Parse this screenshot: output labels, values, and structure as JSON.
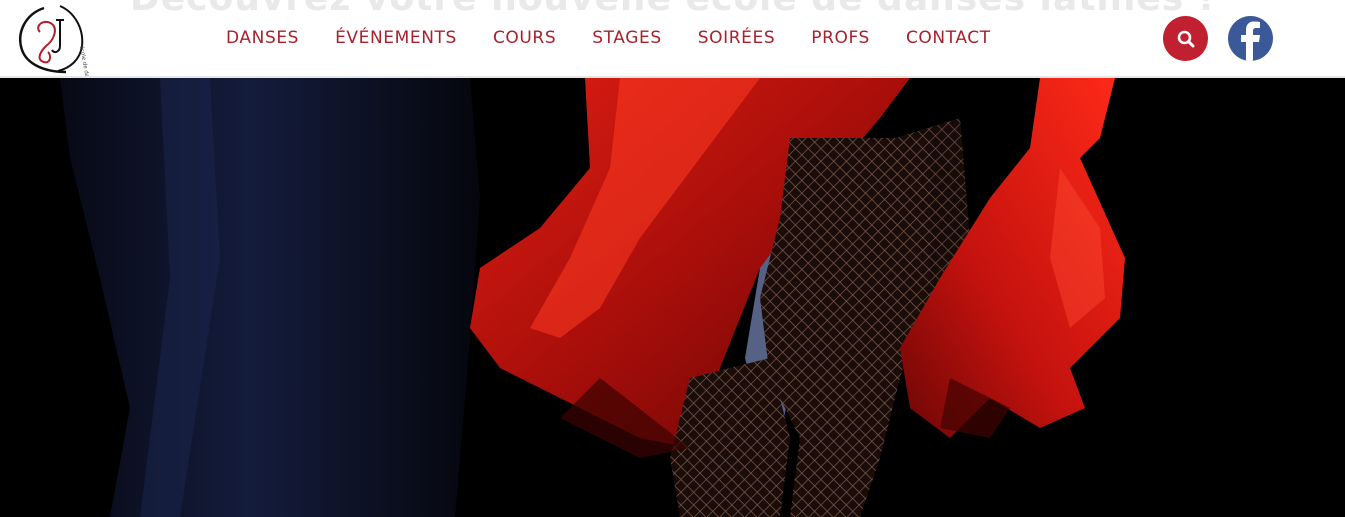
{
  "headline": {
    "text": "Découvrez votre nouvelle école de danses latines !"
  },
  "logo": {
    "tagline": "école de danse"
  },
  "nav": {
    "items": [
      {
        "label": "DANSES"
      },
      {
        "label": "ÉVÉNEMENTS"
      },
      {
        "label": "COURS"
      },
      {
        "label": "STAGES"
      },
      {
        "label": "SOIRÉES"
      },
      {
        "label": "PROFS"
      },
      {
        "label": "CONTACT"
      }
    ]
  },
  "icons": {
    "search": "search-icon",
    "facebook": "facebook-icon"
  },
  "colors": {
    "nav_text": "#a8212d",
    "search_bg": "#c0202f",
    "facebook_bg": "#3b5998",
    "hero_bg": "#000000",
    "dress_red": "#d2140f"
  }
}
